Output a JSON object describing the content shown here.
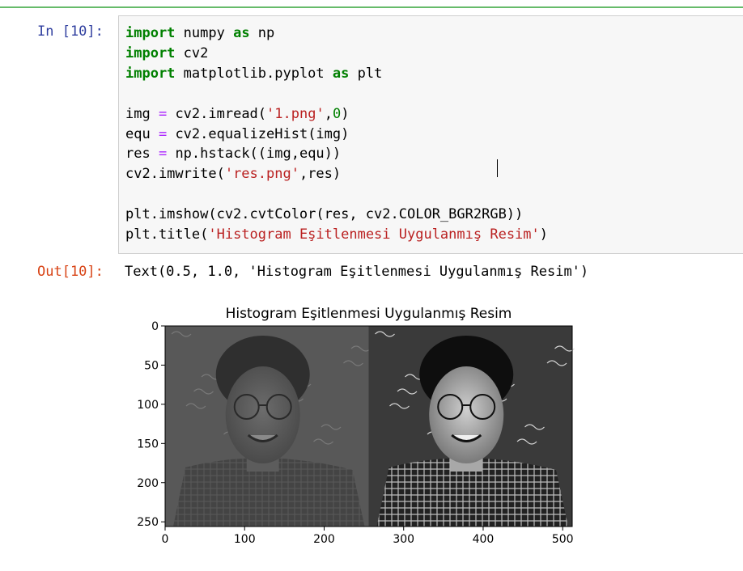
{
  "cell": {
    "prompt_in": "In [10]:",
    "prompt_out": "Out[10]:",
    "code_lines": [
      [
        {
          "t": "import",
          "c": "kw"
        },
        {
          "t": " numpy ",
          "c": ""
        },
        {
          "t": "as",
          "c": "kw"
        },
        {
          "t": " np",
          "c": ""
        }
      ],
      [
        {
          "t": "import",
          "c": "kw"
        },
        {
          "t": " cv2",
          "c": ""
        }
      ],
      [
        {
          "t": "import",
          "c": "kw"
        },
        {
          "t": " matplotlib.pyplot ",
          "c": ""
        },
        {
          "t": "as",
          "c": "kw"
        },
        {
          "t": " plt",
          "c": ""
        }
      ],
      [],
      [
        {
          "t": "img ",
          "c": ""
        },
        {
          "t": "=",
          "c": "op"
        },
        {
          "t": " cv2.imread(",
          "c": ""
        },
        {
          "t": "'1.png'",
          "c": "str"
        },
        {
          "t": ",",
          "c": ""
        },
        {
          "t": "0",
          "c": "num"
        },
        {
          "t": ")",
          "c": ""
        }
      ],
      [
        {
          "t": "equ ",
          "c": ""
        },
        {
          "t": "=",
          "c": "op"
        },
        {
          "t": " cv2.equalizeHist(img)",
          "c": ""
        }
      ],
      [
        {
          "t": "res ",
          "c": ""
        },
        {
          "t": "=",
          "c": "op"
        },
        {
          "t": " np.hstack((img,equ)) ",
          "c": ""
        }
      ],
      [
        {
          "t": "cv2.imwrite(",
          "c": ""
        },
        {
          "t": "'res.png'",
          "c": "str"
        },
        {
          "t": ",res)",
          "c": ""
        }
      ],
      [],
      [
        {
          "t": "plt.imshow(cv2.cvtColor(res, cv2.COLOR_BGR2RGB))",
          "c": ""
        }
      ],
      [
        {
          "t": "plt.title(",
          "c": ""
        },
        {
          "t": "'Histogram Eşitlenmesi Uygulanmış Resim'",
          "c": "str"
        },
        {
          "t": ")",
          "c": ""
        }
      ]
    ],
    "output_text": "Text(0.5, 1.0, 'Histogram Eşitlenmesi Uygulanmış Resim')"
  },
  "chart_data": {
    "type": "image",
    "title": "Histogram Eşitlenmesi Uygulanmış Resim",
    "xlim": [
      0,
      512
    ],
    "ylim": [
      256,
      0
    ],
    "x_ticks": [
      0,
      100,
      200,
      300,
      400,
      500
    ],
    "y_ticks": [
      0,
      50,
      100,
      150,
      200,
      250
    ],
    "panels": [
      {
        "name": "img",
        "x_range": [
          0,
          256
        ]
      },
      {
        "name": "equ",
        "x_range": [
          256,
          512
        ]
      }
    ]
  },
  "colors": {
    "prompt_in": "#303f9f",
    "prompt_out": "#d84315",
    "keyword": "#008000",
    "string": "#ba2121",
    "cell_border": "#66bb6a"
  }
}
